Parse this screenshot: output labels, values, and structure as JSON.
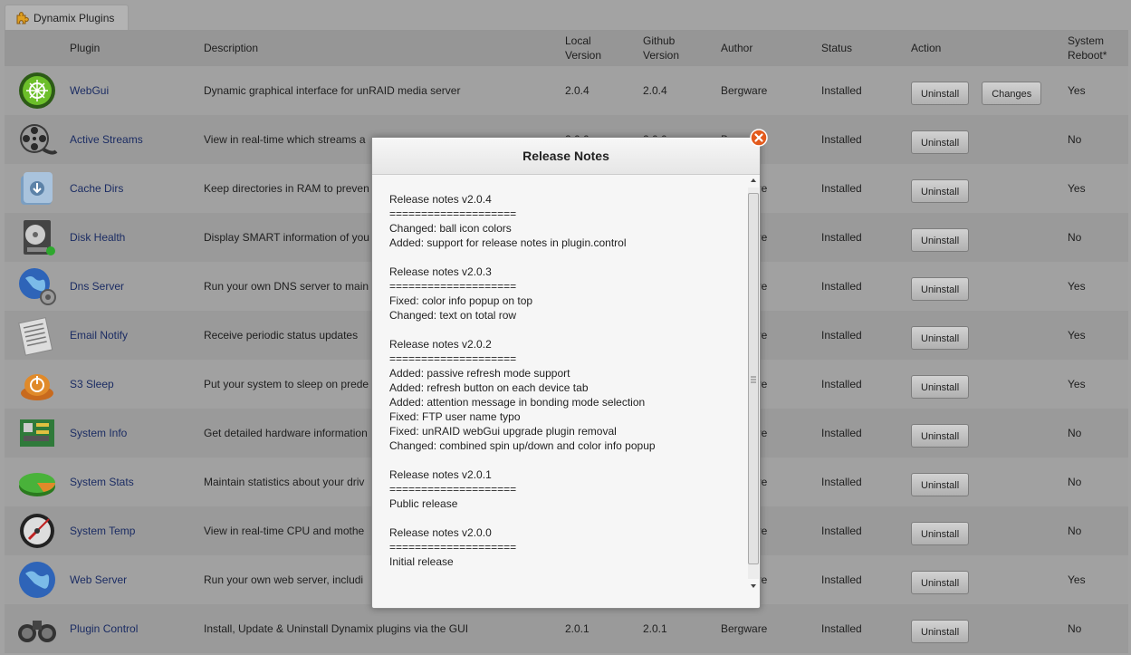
{
  "tab": {
    "label": "Dynamix Plugins",
    "icon": "puzzle-icon"
  },
  "table": {
    "headers": {
      "plugin": "Plugin",
      "description": "Description",
      "local_version_1": "Local",
      "local_version_2": "Version",
      "github_version_1": "Github",
      "github_version_2": "Version",
      "author": "Author",
      "status": "Status",
      "action": "Action",
      "reboot_1": "System",
      "reboot_2": "Reboot*"
    },
    "rows": [
      {
        "name": "WebGui",
        "description": "Dynamic graphical interface for unRAID media server",
        "local": "2.0.4",
        "github": "2.0.4",
        "author": "Bergware",
        "status": "Installed",
        "action": "Uninstall",
        "extra_action": "Changes",
        "reboot": "Yes",
        "icon": "webgui-icon"
      },
      {
        "name": "Active Streams",
        "description": "View in real-time which streams a",
        "local": "2.0.0",
        "github": "2.0.0",
        "author": "Bergware",
        "status": "Installed",
        "action": "Uninstall",
        "reboot": "No",
        "icon": "film-reel-icon"
      },
      {
        "name": "Cache Dirs",
        "description": "Keep directories in RAM to preven",
        "local": "",
        "github": "",
        "author": "Bergware",
        "status": "Installed",
        "action": "Uninstall",
        "reboot": "Yes",
        "icon": "folder-download-icon"
      },
      {
        "name": "Disk Health",
        "description": "Display SMART information of you",
        "local": "",
        "github": "",
        "author": "Bergware",
        "status": "Installed",
        "action": "Uninstall",
        "reboot": "No",
        "icon": "hard-disk-icon"
      },
      {
        "name": "Dns Server",
        "description": "Run your own DNS server to main",
        "local": "",
        "github": "",
        "author": "Bergware",
        "status": "Installed",
        "action": "Uninstall",
        "reboot": "Yes",
        "icon": "globe-gear-icon"
      },
      {
        "name": "Email Notify",
        "description": "Receive periodic status updates",
        "local": "",
        "github": "",
        "author": "Bergware",
        "status": "Installed",
        "action": "Uninstall",
        "reboot": "Yes",
        "icon": "newspaper-icon"
      },
      {
        "name": "S3 Sleep",
        "description": "Put your system to sleep on prede",
        "local": "",
        "github": "",
        "author": "Bergware",
        "status": "Installed",
        "action": "Uninstall",
        "reboot": "Yes",
        "icon": "power-icon"
      },
      {
        "name": "System Info",
        "description": "Get detailed hardware information",
        "local": "",
        "github": "",
        "author": "Bergware",
        "status": "Installed",
        "action": "Uninstall",
        "reboot": "No",
        "icon": "motherboard-icon"
      },
      {
        "name": "System Stats",
        "description": "Maintain statistics about your driv",
        "local": "",
        "github": "",
        "author": "Bergware",
        "status": "Installed",
        "action": "Uninstall",
        "reboot": "No",
        "icon": "pie-chart-icon"
      },
      {
        "name": "System Temp",
        "description": "View in real-time CPU and mothe",
        "local": "",
        "github": "",
        "author": "Bergware",
        "status": "Installed",
        "action": "Uninstall",
        "reboot": "No",
        "icon": "thermometer-gauge-icon"
      },
      {
        "name": "Web Server",
        "description": "Run your own web server, includi",
        "local": "",
        "github": "",
        "author": "Bergware",
        "status": "Installed",
        "action": "Uninstall",
        "reboot": "Yes",
        "icon": "globe-icon"
      },
      {
        "name": "Plugin Control",
        "description": "Install, Update & Uninstall Dynamix plugins via the GUI",
        "local": "2.0.1",
        "github": "2.0.1",
        "author": "Bergware",
        "status": "Installed",
        "action": "Uninstall",
        "reboot": "No",
        "icon": "binoculars-icon"
      }
    ]
  },
  "modal": {
    "title": "Release Notes",
    "close_icon": "close-icon",
    "notes": [
      [
        "Release notes v2.0.4",
        "====================",
        "Changed: ball icon colors",
        "Added: support for release notes in plugin.control"
      ],
      [
        "Release notes v2.0.3",
        "====================",
        "Fixed: color info popup on top",
        "Changed: text on total row"
      ],
      [
        "Release notes v2.0.2",
        "====================",
        "Added: passive refresh mode support",
        "Added: refresh button on each device tab",
        "Added: attention message in bonding mode selection",
        "Fixed: FTP user name typo",
        "Fixed: unRAID webGui upgrade plugin removal",
        "Changed: combined spin up/down and color info popup"
      ],
      [
        "Release notes v2.0.1",
        "====================",
        "Public release"
      ],
      [
        "Release notes v2.0.0",
        "====================",
        "Initial release"
      ]
    ]
  },
  "colors": {
    "link": "#1b2c63",
    "background": "#a3a3a3",
    "close": "#e35a1c"
  }
}
